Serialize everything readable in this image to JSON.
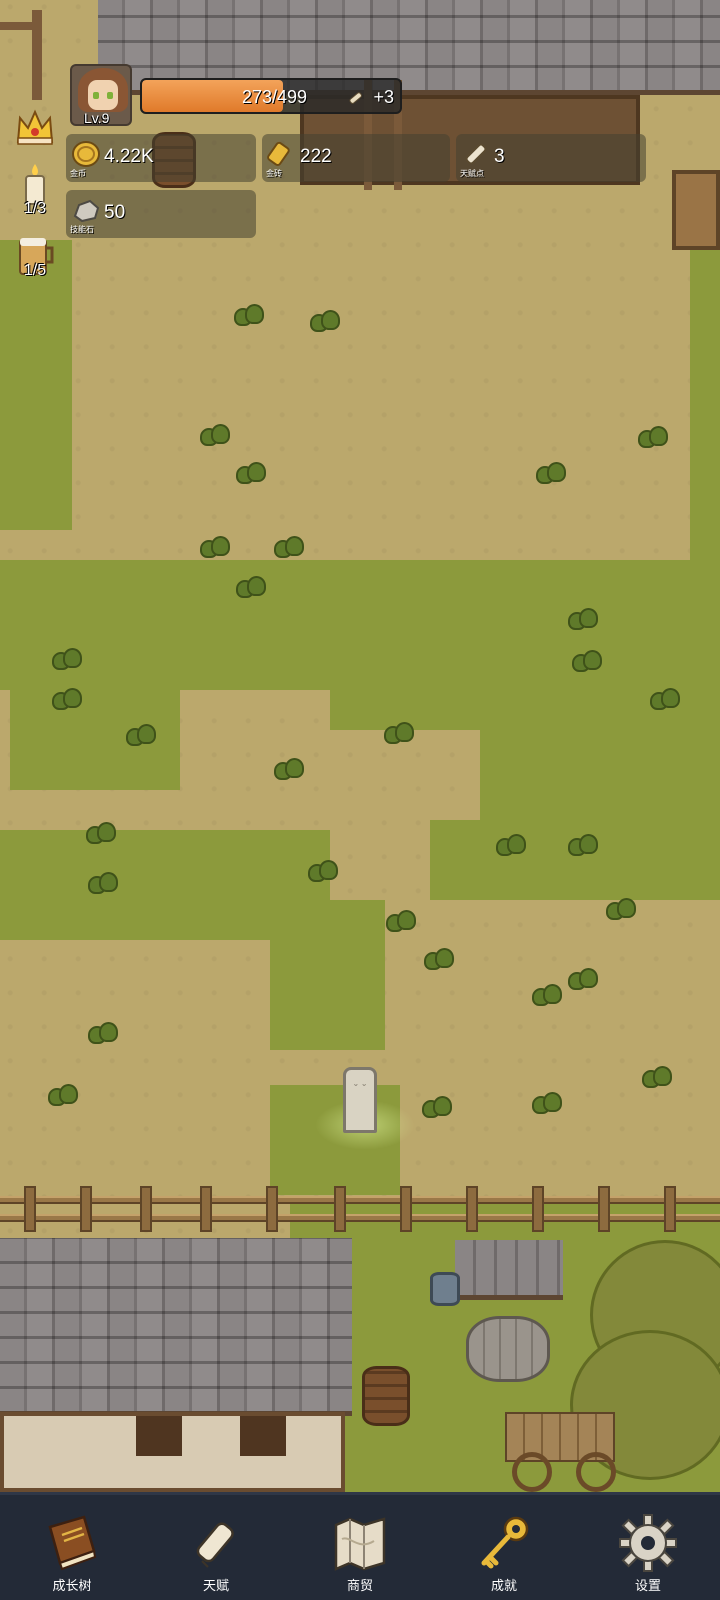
{
  "player": {
    "level": "Lv.9",
    "xp_text": "273/499",
    "xp_fraction": 0.547,
    "xp_bonus": "+3"
  },
  "resources": {
    "gold": {
      "value": "4.22K",
      "caption": "金币",
      "icon": "gold-coin-icon"
    },
    "gold_brick": {
      "value": "222",
      "caption": "金砖",
      "icon": "gold-brick-icon"
    },
    "talent_points": {
      "value": "3",
      "caption": "天赋点",
      "icon": "scroll-icon"
    },
    "skill_stone": {
      "value": "50",
      "caption": "技能石",
      "icon": "stone-icon"
    }
  },
  "side": {
    "crown": {
      "icon": "crown-icon"
    },
    "candle": {
      "count": "1/3",
      "icon": "candle-icon"
    },
    "beer": {
      "count": "1/5",
      "icon": "beer-mug-icon"
    }
  },
  "nav": {
    "items": [
      {
        "label": "成长树",
        "icon": "book-icon"
      },
      {
        "label": "天赋",
        "icon": "scroll-icon"
      },
      {
        "label": "商贸",
        "icon": "map-icon"
      },
      {
        "label": "成就",
        "icon": "key-icon"
      },
      {
        "label": "设置",
        "icon": "gear-icon"
      }
    ]
  },
  "colors": {
    "xp_fill": "#e07a2a",
    "nav_bg": "#232a37",
    "grass": "#8c9a3c",
    "dirt": "#bba86c"
  }
}
